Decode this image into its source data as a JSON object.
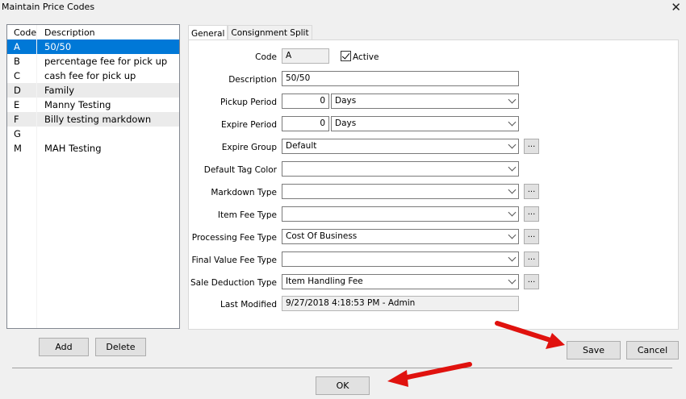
{
  "window": {
    "title": "Maintain Price Codes",
    "close_glyph": "✕"
  },
  "list": {
    "headers": {
      "code": "Code",
      "description": "Description"
    },
    "rows": [
      {
        "code": "A",
        "description": "50/50",
        "selected": true
      },
      {
        "code": "B",
        "description": "percentage fee for pick up"
      },
      {
        "code": "C",
        "description": "cash fee for pick up"
      },
      {
        "code": "D",
        "description": "Family"
      },
      {
        "code": "E",
        "description": "Manny Testing"
      },
      {
        "code": "F",
        "description": "Billy testing markdown"
      },
      {
        "code": "G",
        "description": ""
      },
      {
        "code": "M",
        "description": "MAH Testing"
      }
    ]
  },
  "buttons": {
    "add": "Add",
    "delete": "Delete",
    "save": "Save",
    "cancel": "Cancel",
    "ok": "OK",
    "ellipsis": "..."
  },
  "tabs": {
    "general": "General",
    "consignment_split": "Consignment Split"
  },
  "form": {
    "code": {
      "label": "Code",
      "value": "A"
    },
    "active": {
      "label": "Active",
      "checked": true
    },
    "description": {
      "label": "Description",
      "value": "50/50"
    },
    "pickup_period": {
      "label": "Pickup Period",
      "value": "0",
      "unit": "Days"
    },
    "expire_period": {
      "label": "Expire Period",
      "value": "0",
      "unit": "Days"
    },
    "expire_group": {
      "label": "Expire Group",
      "value": "Default"
    },
    "default_tag_color": {
      "label": "Default Tag Color",
      "value": ""
    },
    "markdown_type": {
      "label": "Markdown Type",
      "value": ""
    },
    "item_fee_type": {
      "label": "Item Fee Type",
      "value": ""
    },
    "processing_fee_type": {
      "label": "Processing Fee Type",
      "value": "Cost Of Business"
    },
    "final_value_fee_type": {
      "label": "Final Value Fee Type",
      "value": ""
    },
    "sale_deduction_type": {
      "label": "Sale Deduction Type",
      "value": "Item Handling Fee"
    },
    "last_modified": {
      "label": "Last Modified",
      "value": "9/27/2018 4:18:53 PM - Admin"
    }
  },
  "colors": {
    "selection": "#0078d7",
    "arrow": "#e0120e"
  }
}
